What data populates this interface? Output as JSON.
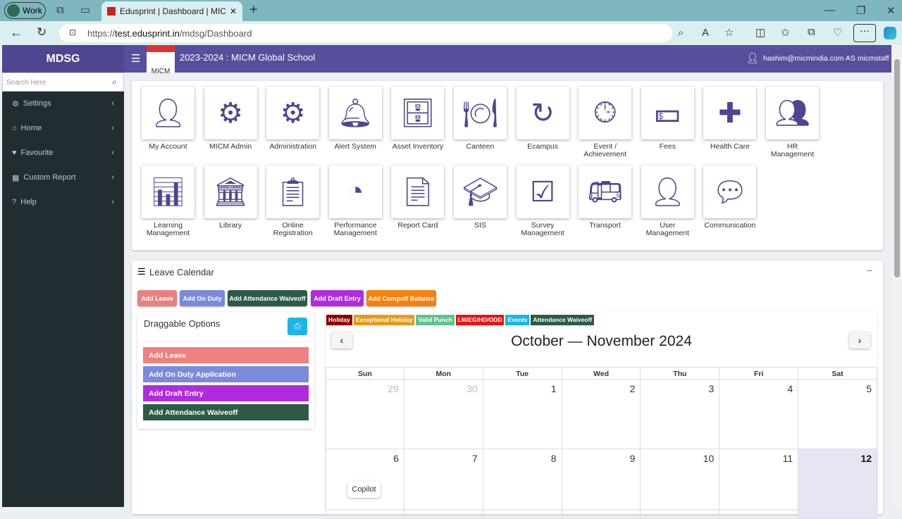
{
  "browser": {
    "profile": "Work",
    "tab_title": "Edusprint | Dashboard | MICM De",
    "url_prefix": "https://",
    "url_host": "test.edusprint.in",
    "url_path": "/mdsg/Dashboard"
  },
  "header": {
    "brand": "MDSG",
    "logo": "MICM",
    "school": "2023-2024 : MICM Global School",
    "user": "hashim@micmindia.com AS micmstaff"
  },
  "sidebar": {
    "search_placeholder": "Search Here",
    "items": [
      {
        "label": "Settings",
        "icon": "gears-icon"
      },
      {
        "label": "Home",
        "icon": "home-icon"
      },
      {
        "label": "Favourite",
        "icon": "heart-icon"
      },
      {
        "label": "Custom Report",
        "icon": "table-icon"
      },
      {
        "label": "Help",
        "icon": "question-icon"
      }
    ]
  },
  "modules": [
    {
      "label": "My Account"
    },
    {
      "label": "MICM Admin"
    },
    {
      "label": "Administration"
    },
    {
      "label": "Alert System"
    },
    {
      "label": "Asset Inventory"
    },
    {
      "label": "Canteen"
    },
    {
      "label": "Ecampus"
    },
    {
      "label": "Event / Achievement"
    },
    {
      "label": "Fees"
    },
    {
      "label": "Health Care"
    },
    {
      "label": "HR Management"
    },
    {
      "label": "Learning Management"
    },
    {
      "label": "Library"
    },
    {
      "label": "Online Registration"
    },
    {
      "label": "Performance Management"
    },
    {
      "label": "Report Card"
    },
    {
      "label": "SIS"
    },
    {
      "label": "Survey Management"
    },
    {
      "label": "Transport"
    },
    {
      "label": "User Management"
    },
    {
      "label": "Communication"
    }
  ],
  "leave": {
    "title": "Leave Calendar",
    "buttons": [
      {
        "label": "Add Leave",
        "color": "#e98080"
      },
      {
        "label": "Add On Duty",
        "color": "#7b8ad9"
      },
      {
        "label": "Add Attendance Waiveoff",
        "color": "#2d5a46"
      },
      {
        "label": "Add Draft Entry",
        "color": "#b02be0"
      },
      {
        "label": "Add Compoff Balance",
        "color": "#f5820f"
      }
    ],
    "draggable_title": "Draggable Options",
    "draggable": [
      {
        "label": "Add Leave",
        "color": "#f08080"
      },
      {
        "label": "Add On Duty Application",
        "color": "#7b8ad9"
      },
      {
        "label": "Add Draft Entry",
        "color": "#b02be0"
      },
      {
        "label": "Add Attendance Waiveoff",
        "color": "#2d5a46"
      }
    ],
    "legend": [
      {
        "label": "Holiday",
        "color": "#8b0000"
      },
      {
        "label": "Exceptional Holiday",
        "color": "#e49b1a"
      },
      {
        "label": "Valid Punch",
        "color": "#5fc28f"
      },
      {
        "label": "LM/EG/HD/ODD",
        "color": "#ee1111"
      },
      {
        "label": "Events",
        "color": "#1bb5e6"
      },
      {
        "label": "Attendance Waiveoff",
        "color": "#2d5a46"
      }
    ],
    "calendar_title": "October — November 2024",
    "weekdays": [
      "Sun",
      "Mon",
      "Tue",
      "Wed",
      "Thu",
      "Fri",
      "Sat"
    ],
    "weeks": [
      [
        "29",
        "30",
        "1",
        "2",
        "3",
        "4",
        "5"
      ],
      [
        "6",
        "7",
        "8",
        "9",
        "10",
        "11",
        "12"
      ]
    ],
    "today": "12"
  },
  "copilot": "Copilot"
}
